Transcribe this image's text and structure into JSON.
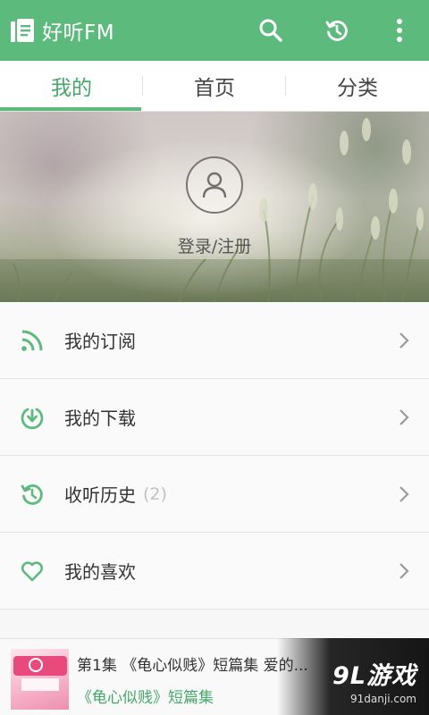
{
  "app": {
    "title": "好听FM",
    "accent": "#5cba7d"
  },
  "toolbar": {
    "search_icon": "search-icon",
    "history_icon": "history-icon",
    "more_icon": "more-vert-icon"
  },
  "tabs": [
    {
      "label": "我的",
      "active": true
    },
    {
      "label": "首页",
      "active": false
    },
    {
      "label": "分类",
      "active": false
    }
  ],
  "profile": {
    "login_label": "登录/注册",
    "avatar_icon": "user-icon"
  },
  "menu": [
    {
      "label": "我的订阅",
      "icon": "rss-icon",
      "count": ""
    },
    {
      "label": "我的下载",
      "icon": "download-icon",
      "count": ""
    },
    {
      "label": "收听历史",
      "icon": "history-icon",
      "count": "(2)"
    },
    {
      "label": "我的喜欢",
      "icon": "heart-icon",
      "count": ""
    }
  ],
  "player": {
    "track_title": "第1集 《龟心似贱》短篇集 爱的...",
    "series": "《龟心似贱》短篇集"
  },
  "watermark": {
    "brand": "9L游戏",
    "url": "91danji.com"
  }
}
